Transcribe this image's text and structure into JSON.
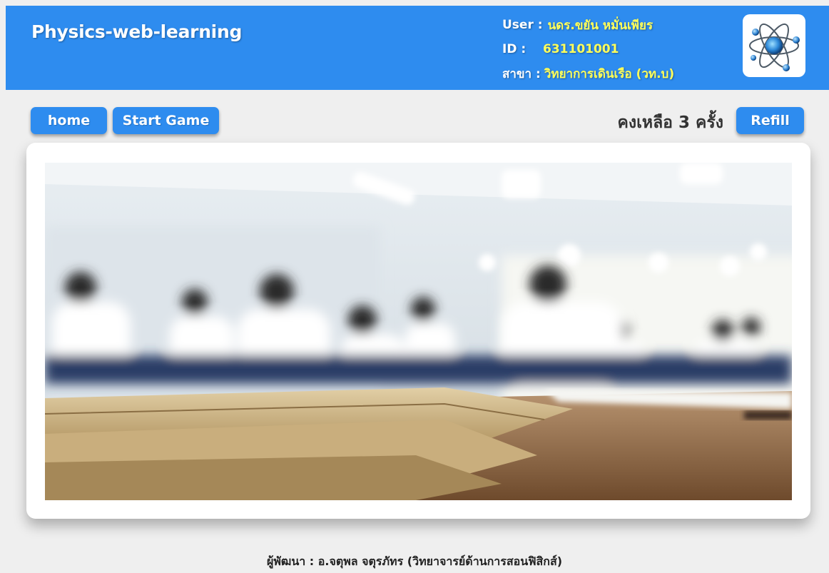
{
  "header": {
    "brand": "Physics-web-learning",
    "user_label": "User :",
    "user_value": "นดร.ขยัน หมั่นเพียร",
    "id_label": "ID :",
    "id_value": "631101001",
    "branch_label": "สาขา :",
    "branch_value": "วิทยาการเดินเรือ (วท.บ)",
    "logo_icon": "atom-logo-icon"
  },
  "toolbar": {
    "home_label": "home",
    "start_label": "Start Game",
    "remaining_text": "คงเหลือ 3 ครั้ง",
    "refill_label": "Refill"
  },
  "hero": {
    "image": "blurred-classroom-exam-photo"
  },
  "footer": {
    "credit": "ผู้พัฒนา : อ.จตุพล จตุรภัทร (วิทยาจารย์ด้านการสอนฟิสิกส์)"
  },
  "colors": {
    "accent": "#2e8cef",
    "highlight": "#ffff5a",
    "background": "#efefef"
  }
}
